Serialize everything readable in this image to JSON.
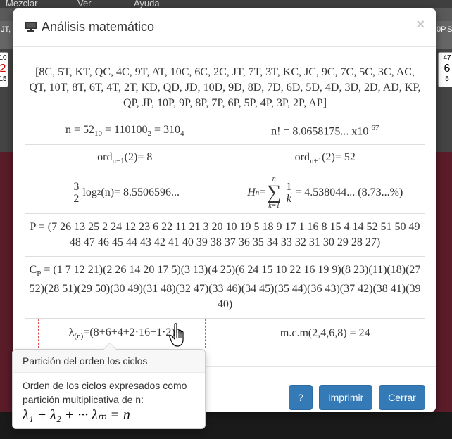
{
  "background": {
    "menu": [
      "Mezclar",
      "Ver",
      "Ayuda"
    ],
    "strip_left": "JT,",
    "strip_right": "0P,S",
    "card_left": [
      "10",
      "2",
      "15"
    ],
    "card_right": [
      "47",
      "6",
      "5"
    ]
  },
  "modal": {
    "title": "Análisis matemático",
    "close": "×",
    "deck": "[8C, 5T, KT, QC, 4C, 9T, AT, 10C, 6C, 2C, JT, 7T, 3T, KC, JC, 9C, 7C, 5C, 3C, AC, QT, 10T, 8T, 6T, 4T, 2T, KD, QD, JD, 10D, 9D, 8D, 7D, 6D, 5D, 4D, 3D, 2D, AD, KP, QP, JP, 10P, 9P, 8P, 7P, 6P, 5P, 4P, 3P, 2P, AP]",
    "n": {
      "prefix": "n = 52",
      "sub1": "10",
      "mid1": " = 110100",
      "sub2": "2",
      "mid2": " = 310",
      "sub3": "4"
    },
    "factorial": {
      "text": "n! = 8.0658175... x10 ",
      "exp": "67"
    },
    "ord_minus": {
      "pre": "ord",
      "sub": "n−1",
      "post": "(2)= 8"
    },
    "ord_plus": {
      "pre": "ord",
      "sub": "n+1",
      "post": "(2)= 52"
    },
    "log": {
      "num": "3",
      "den": "2",
      "pre": "log",
      "sub": "2",
      "post": "(n)= 8.5506596..."
    },
    "harmonic": {
      "h": "H",
      "hsub": "n",
      "eq": " =",
      "sum_top": "n",
      "sum_sym": "∑",
      "sum_bot": "k=1",
      "fnum": "1",
      "fden": "k",
      "post": "= 4.538044... (8.73...%)"
    },
    "perm": "P = (7 26 13 25 2 24 12 23 6 22 11 21 3 20 10 19 5 18 9 17 1 16 8 15 4 14 52 51 50 49 48 47 46 45 44 43 42 41 40 39 38 37 36 35 34 33 32 31 30 29 28 27)",
    "cycles_pre": "C",
    "cycles_sub": "P",
    "cycles": " = (1 7 12 21)(2 26 14 20 17 5)(3 13)(4 25)(6 24 15 10 22 16 19 9)(8 23)(11)(18)(27 52)(28 51)(29 50)(30 49)(31 48)(32 47)(33 46)(34 45)(35 44)(36 43)(37 42)(38 41)(39 40)",
    "lambda": {
      "pre": "λ",
      "sub": "(n)",
      "post": "=(8+6+4+2·16+1·2)"
    },
    "lcm": "m.c.m(2,4,6,8) = 24",
    "buttons": {
      "help": "?",
      "print": "Imprimir",
      "close": "Cerrar"
    }
  },
  "popover": {
    "title": "Partición del orden los ciclos",
    "text": "Orden de los ciclos expresados como partición multiplicativa de n:",
    "formula": "λ₁ + λ₂ + ··· λₘ = n"
  },
  "colors": {
    "primary": "#337ab7",
    "dash": "#e05050"
  }
}
